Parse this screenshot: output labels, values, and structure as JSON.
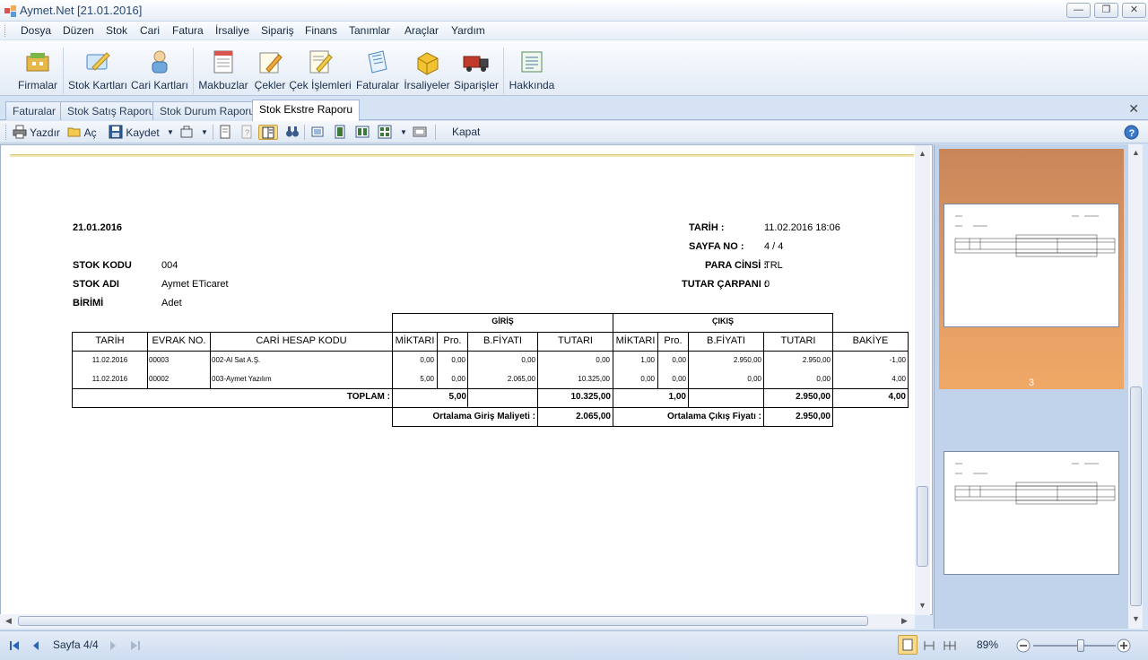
{
  "window": {
    "title": "Aymet.Net [21.01.2016]",
    "controls": {
      "minimize": "—",
      "restore": "❐",
      "close": "✕"
    }
  },
  "menu": [
    "Dosya",
    "Düzen",
    "Stok",
    "Cari",
    "Fatura",
    "İrsaliye",
    "Sipariş",
    "Finans",
    "Tanımlar",
    "Araçlar",
    "Yardım"
  ],
  "toolbar": [
    {
      "label": "Firmalar",
      "icon": "companies-icon"
    },
    {
      "label": "Stok Kartları",
      "icon": "stock-cards-icon"
    },
    {
      "label": "Cari Kartları",
      "icon": "accounts-icon"
    },
    {
      "label": "Makbuzlar",
      "icon": "receipts-icon"
    },
    {
      "label": "Çekler",
      "icon": "cheques-icon"
    },
    {
      "label": "Çek İşlemleri",
      "icon": "cheque-operations-icon"
    },
    {
      "label": "Faturalar",
      "icon": "invoices-icon"
    },
    {
      "label": "İrsaliyeler",
      "icon": "waybills-icon"
    },
    {
      "label": "Siparişler",
      "icon": "orders-icon"
    },
    {
      "label": "Hakkında",
      "icon": "about-icon"
    }
  ],
  "tabs": [
    {
      "label": "Faturalar",
      "active": false
    },
    {
      "label": "Stok Satış Raporu",
      "active": false
    },
    {
      "label": "Stok Durum Raporu",
      "active": false
    },
    {
      "label": "Stok Ekstre Raporu",
      "active": true
    }
  ],
  "printbar": {
    "print": "Yazdır",
    "open": "Aç",
    "save": "Kaydet",
    "close": "Kapat"
  },
  "report": {
    "date_left": "21.01.2016",
    "tarih_label": "TARİH :",
    "tarih_value": "11.02.2016 18:06",
    "sayfa_label": "SAYFA NO :",
    "sayfa_value": "4 / 4",
    "para_label": "PARA CİNSİ :",
    "para_value": "TRL",
    "tutar_label": "TUTAR ÇARPANI :",
    "tutar_value": "0",
    "stok_kodu_label": "STOK KODU",
    "stok_kodu_value": "004",
    "stok_adi_label": "STOK ADI",
    "stok_adi_value": "Aymet ETicaret",
    "birimi_label": "BİRİMİ",
    "birimi_value": "Adet",
    "giris_header": "GİRİŞ",
    "cikis_header": "ÇIKIŞ",
    "columns": [
      "TARİH",
      "EVRAK NO.",
      "CARİ HESAP KODU",
      "MİKTARI",
      "Pro.",
      "B.FİYATI",
      "TUTARI",
      "MİKTARI",
      "Pro.",
      "B.FİYATI",
      "TUTARI",
      "BAKİYE"
    ],
    "rows": [
      [
        "11.02.2016",
        "00003",
        "002-Al Sat A.Ş.",
        "0,00",
        "0,00",
        "0,00",
        "0,00",
        "1,00",
        "0,00",
        "2.950,00",
        "2.950,00",
        "-1,00"
      ],
      [
        "11.02.2016",
        "00002",
        "003-Aymet Yazılım",
        "5,00",
        "0,00",
        "2.065,00",
        "10.325,00",
        "0,00",
        "0,00",
        "0,00",
        "0,00",
        "4,00"
      ]
    ],
    "toplam_label": "TOPLAM :",
    "toplam": {
      "giris_miktar": "5,00",
      "giris_tutar": "10.325,00",
      "cikis_miktar": "1,00",
      "cikis_tutar": "2.950,00",
      "bakiye": "4,00"
    },
    "ort_giris_label": "Ortalama Giriş Maliyeti :",
    "ort_giris_value": "2.065,00",
    "ort_cikis_label": "Ortalama Çıkış Fiyatı :",
    "ort_cikis_value": "2.950,00"
  },
  "thumbnails": {
    "selected_page_number": "3"
  },
  "status": {
    "page_text": "Sayfa 4/4",
    "zoom": "89%",
    "zoom_fraction": 0.58
  }
}
